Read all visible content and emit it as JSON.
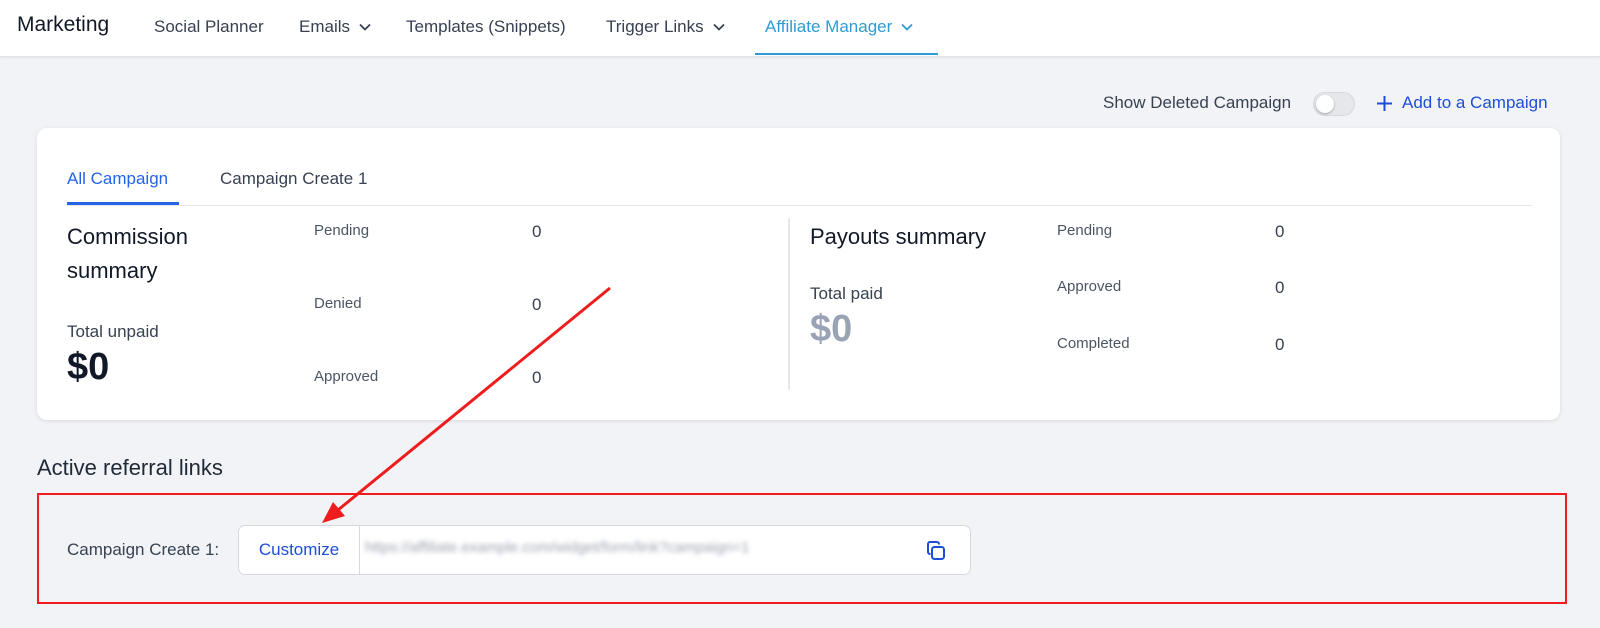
{
  "nav": {
    "brand": "Marketing",
    "items": [
      {
        "label": "Social Planner"
      },
      {
        "label": "Emails"
      },
      {
        "label": "Templates (Snippets)"
      },
      {
        "label": "Trigger Links"
      },
      {
        "label": "Affiliate Manager"
      }
    ]
  },
  "toolbar": {
    "show_deleted_label": "Show Deleted Campaign",
    "show_deleted_on": false,
    "add_campaign_label": "Add to a Campaign"
  },
  "tabs": [
    {
      "label": "All Campaign"
    },
    {
      "label": "Campaign Create 1"
    }
  ],
  "commission": {
    "title_line1": "Commission",
    "title_line2": "summary",
    "total_label": "Total unpaid",
    "total_value": "$0",
    "stats": [
      {
        "label": "Pending",
        "value": "0"
      },
      {
        "label": "Denied",
        "value": "0"
      },
      {
        "label": "Approved",
        "value": "0"
      }
    ]
  },
  "payouts": {
    "title": "Payouts summary",
    "total_label": "Total paid",
    "total_value": "$0",
    "stats": [
      {
        "label": "Pending",
        "value": "0"
      },
      {
        "label": "Approved",
        "value": "0"
      },
      {
        "label": "Completed",
        "value": "0"
      }
    ]
  },
  "referral": {
    "heading": "Active referral links",
    "campaign_label": "Campaign Create 1:",
    "customize_label": "Customize",
    "link_text": "https://affiliate.example.com/widget/form/link?campaign=1"
  },
  "colors": {
    "accent": "#2563eb",
    "nav_active": "#2f9bd6",
    "annotation": "#ee1c1c"
  }
}
